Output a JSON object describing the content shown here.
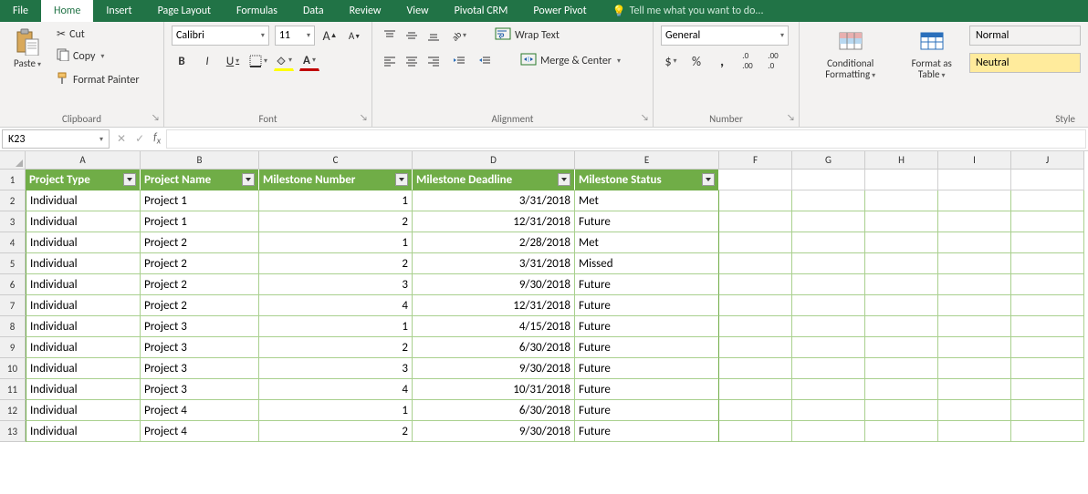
{
  "tabs": [
    "File",
    "Home",
    "Insert",
    "Page Layout",
    "Formulas",
    "Data",
    "Review",
    "View",
    "Pivotal CRM",
    "Power Pivot"
  ],
  "active_tab": "Home",
  "tell_me": "Tell me what you want to do...",
  "ribbon": {
    "clipboard": {
      "paste": "Paste",
      "cut": "Cut",
      "copy": "Copy",
      "format_painter": "Format Painter",
      "label": "Clipboard"
    },
    "font": {
      "name": "Calibri",
      "size": "11",
      "label": "Font",
      "bold": "B",
      "italic": "I",
      "underline": "U"
    },
    "alignment": {
      "wrap": "Wrap Text",
      "merge": "Merge & Center",
      "label": "Alignment"
    },
    "number": {
      "format": "General",
      "label": "Number"
    },
    "styles": {
      "cond_fmt": "Conditional Formatting",
      "fmt_table": "Format as Table",
      "normal": "Normal",
      "neutral": "Neutral",
      "label": "Style"
    }
  },
  "name_box": "K23",
  "columns": [
    "A",
    "B",
    "C",
    "D",
    "E",
    "F",
    "G",
    "H",
    "I",
    "J"
  ],
  "col_widths": [
    "cA",
    "cB",
    "cC",
    "cD",
    "cE",
    "cF",
    "cG",
    "cH",
    "cI",
    "cJ"
  ],
  "headers": [
    "Project Type",
    "Project Name",
    "Milestone Number",
    "Milestone Deadline",
    "Milestone Status"
  ],
  "rows": [
    {
      "n": 2,
      "type": "Individual",
      "name": "Project 1",
      "num": "1",
      "deadline": "3/31/2018",
      "status": "Met"
    },
    {
      "n": 3,
      "type": "Individual",
      "name": "Project 1",
      "num": "2",
      "deadline": "12/31/2018",
      "status": "Future"
    },
    {
      "n": 4,
      "type": "Individual",
      "name": "Project 2",
      "num": "1",
      "deadline": "2/28/2018",
      "status": "Met"
    },
    {
      "n": 5,
      "type": "Individual",
      "name": "Project 2",
      "num": "2",
      "deadline": "3/31/2018",
      "status": "Missed"
    },
    {
      "n": 6,
      "type": "Individual",
      "name": "Project 2",
      "num": "3",
      "deadline": "9/30/2018",
      "status": "Future"
    },
    {
      "n": 7,
      "type": "Individual",
      "name": "Project 2",
      "num": "4",
      "deadline": "12/31/2018",
      "status": "Future"
    },
    {
      "n": 8,
      "type": "Individual",
      "name": "Project 3",
      "num": "1",
      "deadline": "4/15/2018",
      "status": "Future"
    },
    {
      "n": 9,
      "type": "Individual",
      "name": "Project 3",
      "num": "2",
      "deadline": "6/30/2018",
      "status": "Future"
    },
    {
      "n": 10,
      "type": "Individual",
      "name": "Project 3",
      "num": "3",
      "deadline": "9/30/2018",
      "status": "Future"
    },
    {
      "n": 11,
      "type": "Individual",
      "name": "Project 3",
      "num": "4",
      "deadline": "10/31/2018",
      "status": "Future"
    },
    {
      "n": 12,
      "type": "Individual",
      "name": "Project 4",
      "num": "1",
      "deadline": "6/30/2018",
      "status": "Future"
    },
    {
      "n": 13,
      "type": "Individual",
      "name": "Project 4",
      "num": "2",
      "deadline": "9/30/2018",
      "status": "Future"
    }
  ]
}
